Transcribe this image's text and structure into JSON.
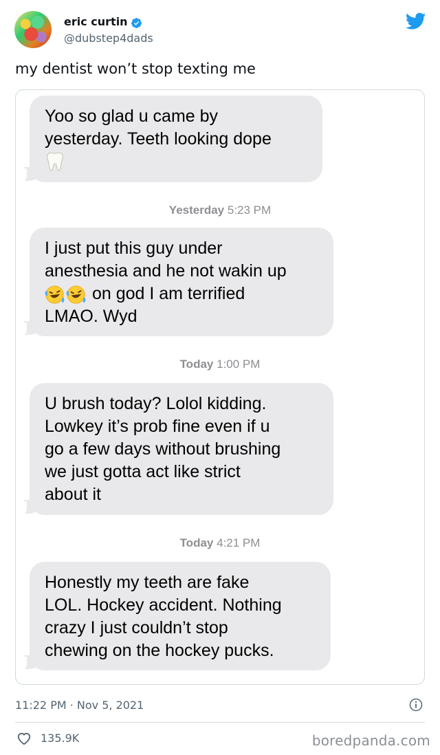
{
  "tweet": {
    "display_name": "eric curtin",
    "handle": "@dubstep4dads",
    "text": "my dentist won’t stop texting me",
    "timestamp": "11:22 PM · Nov 5, 2021",
    "likes": "135.9K",
    "verified_color": "#1d9bf0",
    "brand_color": "#1d9bf0"
  },
  "conversation": {
    "messages": [
      {
        "text": "Yoo so glad u came by\nyesterday. Teeth looking dope",
        "emoji": "tooth-emoji"
      },
      {
        "stamp_day": "Yesterday",
        "stamp_time": "5:23 PM"
      },
      {
        "line1": "I just put this guy under",
        "line2": "anesthesia and he not wakin up",
        "line3": "on god I am terrified",
        "line4": "LMAO. Wyd",
        "emoji": "rofl-emoji"
      },
      {
        "stamp_day": "Today",
        "stamp_time": "1:00 PM"
      },
      {
        "text": "U brush today? Lolol kidding.\nLowkey it’s prob fine even if u\ngo a few days without brushing\nwe just gotta act like strict\nabout it"
      },
      {
        "stamp_day": "Today",
        "stamp_time": "4:21 PM"
      },
      {
        "text": "Honestly my teeth are fake\nLOL. Hockey accident. Nothing\ncrazy I just couldn’t stop\nchewing on the hockey pucks."
      }
    ],
    "bubble_color": "#e9e9eb"
  },
  "watermark": "boredpanda.com"
}
